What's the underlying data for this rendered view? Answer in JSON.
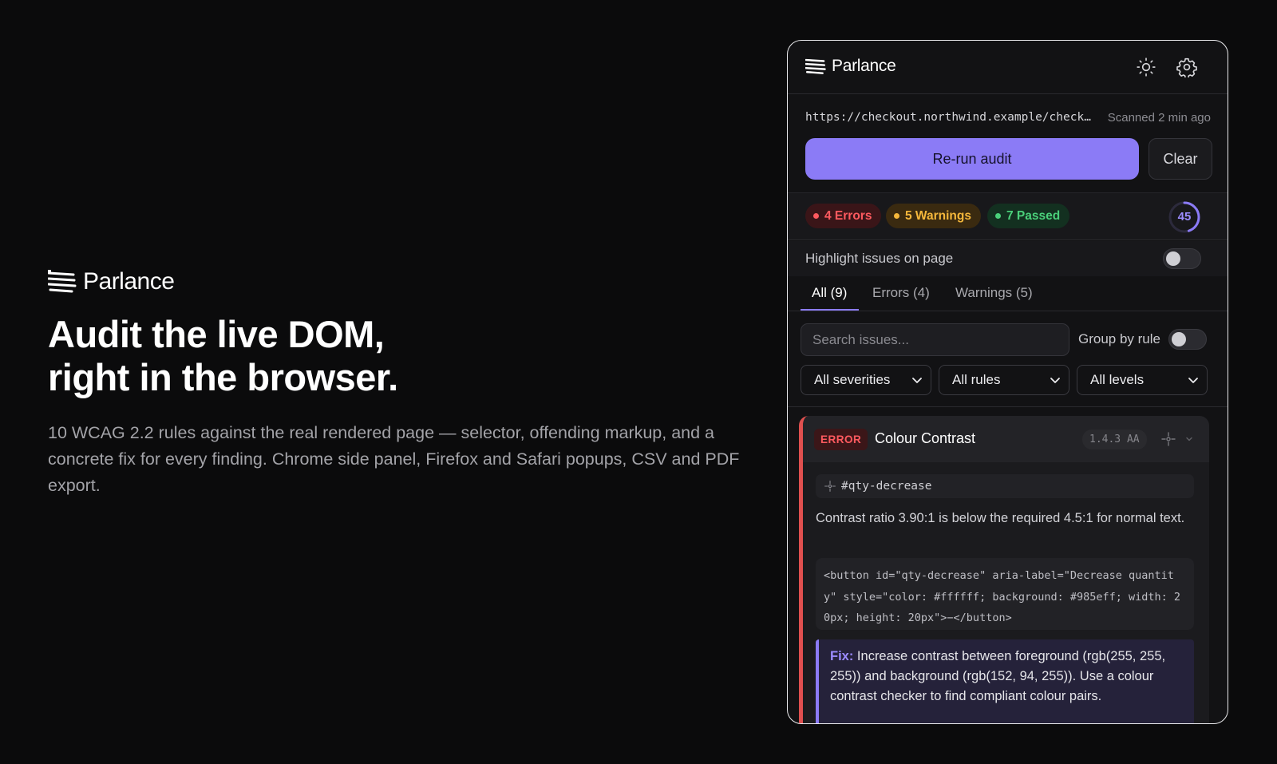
{
  "hero": {
    "brand": "Parlance",
    "title_line1": "Audit the live DOM,",
    "title_line2": "right in the browser.",
    "description": "10 WCAG 2.2 rules against the real rendered page — selector, offending markup, and a concrete fix for every finding. Chrome side panel, Firefox and Safari popups, CSV and PDF export."
  },
  "panel": {
    "brand": "Parlance",
    "header_icons": [
      "sun-icon",
      "gear-icon"
    ],
    "url": "https://checkout.northwind.example/checkout",
    "scanned": "Scanned 2 min ago",
    "rerun_label": "Re-run audit",
    "clear_label": "Clear",
    "stats": {
      "errors": "4 Errors",
      "warnings": "5 Warnings",
      "passed": "7 Passed",
      "score": "45",
      "score_fraction": 0.45
    },
    "highlight_label": "Highlight issues on page",
    "highlight_on": false,
    "tabs": [
      {
        "label": "All (9)",
        "active": true
      },
      {
        "label": "Errors (4)",
        "active": false
      },
      {
        "label": "Warnings (5)",
        "active": false
      }
    ],
    "search_placeholder": "Search issues...",
    "group_label": "Group by rule",
    "group_on": false,
    "filters": {
      "severity": "All severities",
      "rules": "All rules",
      "levels": "All levels"
    },
    "issue": {
      "severity": "ERROR",
      "title": "Colour Contrast",
      "wcag": "1.4.3 AA",
      "selector": "#qty-decrease",
      "message": "Contrast ratio 3.90:1 is below the required 4.5:1 for normal text.",
      "code": "<button id=\"qty-decrease\" aria-label=\"Decrease quantity\" style=\"color: #ffffff; background: #985eff; width: 20px; height: 20px\">−</button>",
      "fix_label": "Fix:",
      "fix_text": " Increase contrast between foreground (rgb(255, 255, 255)) and background (rgb(152, 94, 255)). Use a colour contrast checker to find compliant colour pairs."
    }
  },
  "colors": {
    "accent": "#8b7bf6",
    "error": "#ff5a5f",
    "warning": "#f5b73b",
    "success": "#4ad07a"
  }
}
